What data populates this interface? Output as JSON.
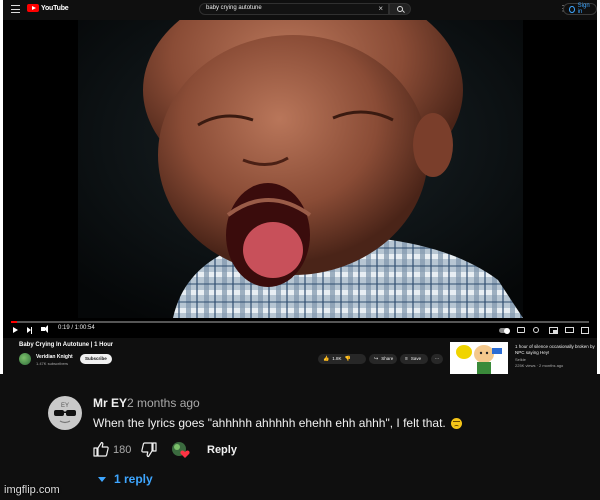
{
  "header": {
    "logo_text": "YouTube",
    "search_value": "baby crying autotune",
    "signin_label": "Sign in"
  },
  "player": {
    "time": "0:19 / 1:00:54",
    "progress": 0.005
  },
  "video": {
    "title": "Baby Crying In Autotune | 1 Hour",
    "channel": "Veridian Knight",
    "subscribers": "1.47K subscribers",
    "subscribe_label": "Subscribe",
    "likes": "1.8K",
    "share_label": "Share",
    "save_label": "Save"
  },
  "recommendation": {
    "title": "1 hour of silence occasionally broken by NPC saying Hey!",
    "channel": "Selkie",
    "meta": "225K views · 2 months ago"
  },
  "comment": {
    "author": "Mr EY",
    "avatar_text": "EY",
    "time": "2 months ago",
    "text": "When the lyrics goes \"ahhhhh ahhhhh ehehh ehh ahhh\", I felt that.",
    "likes": "180",
    "reply_label": "Reply",
    "replies_label": "1 reply"
  },
  "watermark": "imgflip.com",
  "colors": {
    "background": "#0f0f0f",
    "accent_red": "#ff0000",
    "link_blue": "#3ea6ff"
  }
}
